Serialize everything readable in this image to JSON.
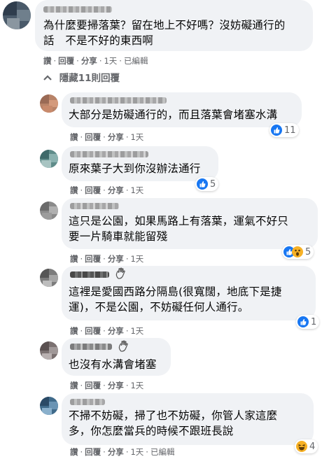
{
  "toggle": {
    "arrow": "chevron-up-icon",
    "label": "隱藏11則回覆"
  },
  "colors": {
    "bubble": "#f0f2f5",
    "like": "#1877f2",
    "emoji": "#f7b125",
    "meta": "#65676b"
  },
  "main_comment": {
    "text": "為什麼要掃落葉？留在地上不好嗎？沒妨礙通行的\n話　不是不好的東西啊",
    "actions": {
      "like": "讚",
      "reply": "回覆",
      "share": "分享",
      "time": "1天",
      "edited": "已編輯"
    }
  },
  "replies": [
    {
      "text": "大部分是妨礙通行的，而且落葉會堵塞水溝",
      "like": "讚",
      "reply": "回覆",
      "share": "分享",
      "time": "1天",
      "reactions": [
        "like"
      ],
      "count": "11"
    },
    {
      "text": "原來葉子大到你沒辦法通行",
      "like": "讚",
      "reply": "回覆",
      "share": "分享",
      "time": "1天",
      "reactions": [
        "like"
      ],
      "count": "5"
    },
    {
      "text": "這只是公園，如果馬路上有落葉，運氣不好只\n要一片騎車就能留殘",
      "like": "讚",
      "reply": "回覆",
      "share": "分享",
      "time": "1天",
      "reactions": [
        "like",
        "wow"
      ],
      "count": "5"
    },
    {
      "text": "這裡是愛國西路分隔島(很寬闊，地底下是捷\n運)，不是公園，不妨礙任何人通行。",
      "like": "讚",
      "reply": "回覆",
      "share": "分享",
      "time": "1天",
      "reactions": [
        "like"
      ],
      "count": "1",
      "badge": "wave-hand-icon"
    },
    {
      "text": "也沒有水溝會堵塞",
      "like": "讚",
      "reply": "回覆",
      "share": "分享",
      "time": "1天",
      "badge": "wave-hand-icon"
    },
    {
      "text": "不掃不妨礙，掃了也不妨礙，你管人家這麼\n多，你怎麼當兵的時候不跟班長說",
      "like": "讚",
      "reply": "回覆",
      "share": "分享",
      "time": "1天",
      "edited": "已編輯",
      "reactions": [
        "haha"
      ],
      "count": "4"
    }
  ]
}
